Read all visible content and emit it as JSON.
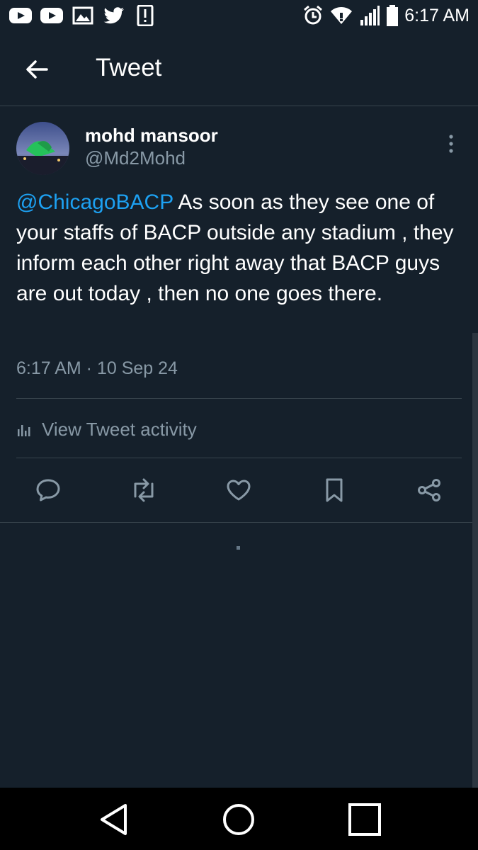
{
  "status_bar": {
    "time": "6:17 AM",
    "left_icons": [
      "youtube-icon",
      "youtube-icon",
      "image-icon",
      "twitter-icon",
      "alert-icon"
    ],
    "right_icons": [
      "alarm-icon",
      "wifi-icon",
      "signal-icon",
      "battery-icon"
    ]
  },
  "header": {
    "title": "Tweet",
    "back_icon": "arrow-left-icon"
  },
  "tweet": {
    "author": {
      "display_name": "mohd mansoor",
      "handle": "@Md2Mohd"
    },
    "mention": "@ChicagoBACP",
    "body": " As soon as they see one of your staffs of BACP outside any stadium , they inform each other right away that BACP guys are out today , then no one goes there.",
    "timestamp": "6:17 AM · 10 Sep 24",
    "activity_label": "View Tweet activity"
  },
  "actions": [
    "reply-icon",
    "retweet-icon",
    "like-icon",
    "bookmark-icon",
    "share-icon"
  ],
  "nav": [
    "back-triangle-icon",
    "home-circle-icon",
    "recents-square-icon"
  ],
  "colors": {
    "background": "#15202b",
    "accent": "#1da1f2",
    "secondary_text": "#8899a6",
    "divider": "#38444d",
    "icon": "#8899a6"
  }
}
